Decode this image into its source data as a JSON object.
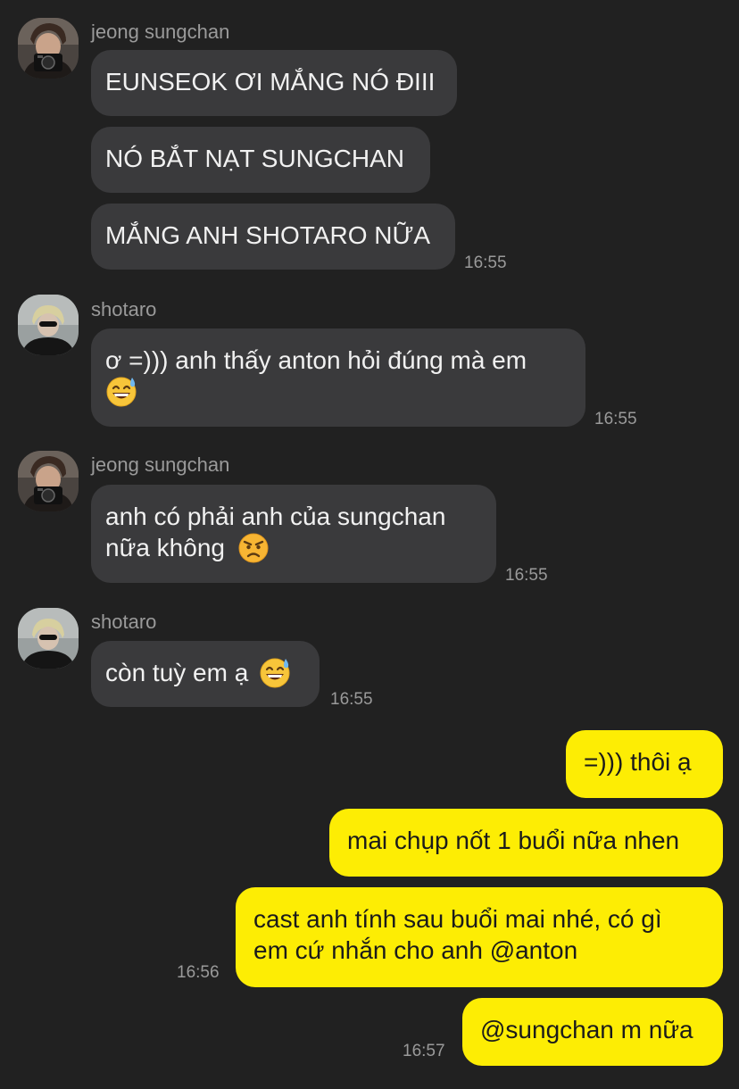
{
  "chat": {
    "messages": [
      {
        "sender": "jeong sungchan",
        "text": "EUNSEOK ƠI MẮNG NÓ ĐIII"
      },
      {
        "text": "NÓ BẮT NẠT SUNGCHAN"
      },
      {
        "text": "MẮNG ANH SHOTARO NỮA",
        "time": "16:55"
      },
      {
        "sender": "shotaro",
        "line1": "ơ =))) anh thấy anton hỏi đúng mà em",
        "emoji": "grinning-sweat",
        "time": "16:55"
      },
      {
        "sender": "jeong sungchan",
        "line1": "anh có phải anh của sungchan",
        "line2": "nữa không",
        "emoji": "angry-face",
        "time": "16:55"
      },
      {
        "sender": "shotaro",
        "text": "còn tuỳ em ạ",
        "emoji": "grinning-sweat",
        "time": "16:55"
      },
      {
        "text": "=))) thôi ạ"
      },
      {
        "text": "mai chụp nốt 1 buổi nữa nhen"
      },
      {
        "line1": "cast anh tính sau buổi mai nhé, có gì",
        "line2": "em cứ nhắn cho anh @anton",
        "time": "16:56"
      },
      {
        "text": "@sungchan m nữa",
        "time": "16:57"
      }
    ]
  },
  "colors": {
    "background": "#212121",
    "received_bubble": "#3a3a3c",
    "sent_bubble": "#fded04",
    "meta_text": "#9a9a9a"
  }
}
